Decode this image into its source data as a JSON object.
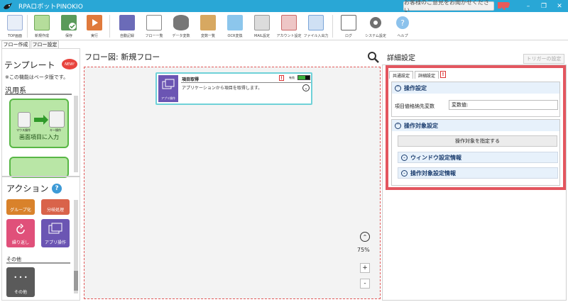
{
  "window": {
    "title": "RPAロボットPINOKIO",
    "feedback_label": "お客様のご意見をお聞かせください",
    "controls": [
      "–",
      "❐",
      "✕"
    ]
  },
  "toolbar": {
    "buttons": [
      {
        "label": "TOP画面",
        "icon": "top-screen-icon",
        "color": "#3a7bc8"
      },
      {
        "label": "新規作成",
        "icon": "new-file-icon",
        "color": "#8cc66d"
      },
      {
        "label": "保存",
        "icon": "save-icon",
        "color": "#5a9a5a"
      },
      {
        "label": "実行",
        "icon": "run-icon",
        "color": "#e07a3c"
      },
      {
        "label": "自動記録",
        "icon": "auto-record-icon",
        "color": "#6b6bb8"
      },
      {
        "label": "フロー一覧",
        "icon": "flow-list-icon",
        "color": "#7a7a7a"
      },
      {
        "label": "データ変数",
        "icon": "data-variable-icon",
        "color": "#555555"
      },
      {
        "label": "変数一覧",
        "icon": "variable-list-icon",
        "color": "#c48a3a"
      },
      {
        "label": "OCR変換",
        "icon": "ocr-icon",
        "color": "#5aa5d8"
      },
      {
        "label": "MAIL設定",
        "icon": "mail-settings-icon",
        "color": "#8a8a8a"
      },
      {
        "label": "アカウント設定",
        "icon": "account-settings-icon",
        "color": "#c96a6a"
      },
      {
        "label": "ファイル入出力",
        "icon": "file-io-icon",
        "color": "#7aa5d8"
      },
      {
        "label": "ログ",
        "icon": "log-icon",
        "color": "#6a6a6a"
      },
      {
        "label": "システム設定",
        "icon": "system-settings-gear-icon",
        "color": "#707070"
      },
      {
        "label": "ヘルプ",
        "icon": "help-icon",
        "color": "#5aa5e0"
      }
    ]
  },
  "main_tabs": [
    {
      "label": "フロー作成",
      "active": true
    },
    {
      "label": "フロー設定",
      "active": false
    }
  ],
  "left_panel": {
    "template_title": "テンプレート",
    "new_badge": "NEW!",
    "beta_note": "※この機能はベータ版です。",
    "category": "汎用系",
    "template_card_label": "画面項目に入力",
    "mouse_label": "マウス操作",
    "keyboard_label": "キー操作",
    "action_title": "アクション",
    "help_mark": "?",
    "actions": [
      {
        "label": "グループ化",
        "color": "#d9822b"
      },
      {
        "label": "分岐処理",
        "color": "#d9634a"
      },
      {
        "label": "繰り返し",
        "color": "#e0507a"
      },
      {
        "label": "アプリ操作",
        "color": "#6b55b3"
      }
    ],
    "other_category": "その他",
    "other_tile_label": "その他",
    "other_tile_dots": "• • •"
  },
  "center": {
    "flow_title": "フロー図:  新規フロー",
    "node": {
      "title": "項目取得",
      "description": "アプリケーションから項目を取得します。",
      "icon_label": "アプリ操作",
      "warning": "!",
      "enabled_label": "有効"
    },
    "zoom_level": "75%",
    "zoom_in": "+",
    "zoom_out": "-"
  },
  "right_panel": {
    "title": "詳細設定",
    "trigger_button": "トリガーの設定",
    "tabs": [
      {
        "label": "共通設定",
        "active": false
      },
      {
        "label": "詳細設定",
        "active": true
      }
    ],
    "tab_warning": "!",
    "operation_section": "操作設定",
    "field_label": "項目値格納先変数",
    "field_value": "変数値:",
    "target_section": "操作対象設定",
    "target_button": "操作対象を指定する",
    "window_info": "ウィンドウ設定情報",
    "target_info": "操作対象設定情報",
    "highlight_color": "#e3565f"
  }
}
